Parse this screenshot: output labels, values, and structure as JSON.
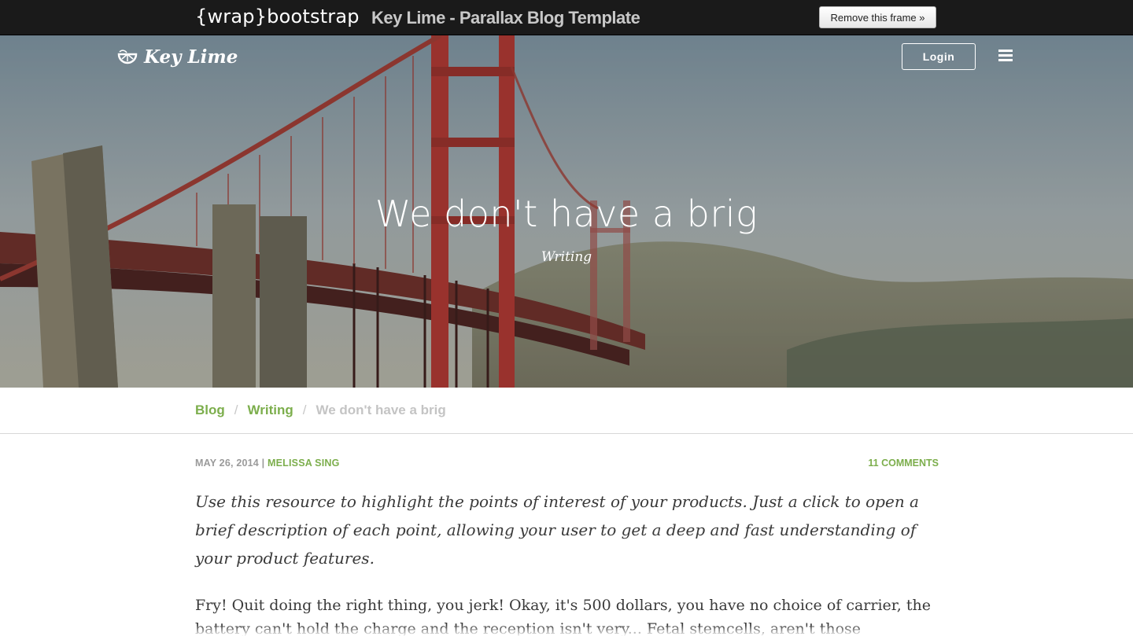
{
  "frame": {
    "logo_text": "{wrap}bootstrap",
    "title": "Key Lime - Parallax Blog Template",
    "remove_button": "Remove this frame »"
  },
  "nav": {
    "brand": "Key Lime",
    "brand_icon": "lime-slice-icon",
    "login_label": "Login",
    "menu_icon": "hamburger-menu-icon"
  },
  "hero": {
    "title": "We don't have a brig",
    "category": "Writing"
  },
  "breadcrumb": {
    "items": [
      {
        "label": "Blog"
      },
      {
        "label": "Writing"
      }
    ],
    "separator": "/",
    "current": "We don't have a brig"
  },
  "post": {
    "date": "MAY 26, 2014",
    "meta_separator": "|",
    "author": "MELISSA SING",
    "comments": "11 COMMENTS",
    "lead": "Use this resource to highlight the points of interest of your products. Just a click to open a brief description of each point, allowing your user to get a deep and fast understanding of your product features.",
    "body": "Fry! Quit doing the right thing, you jerk! Okay, it's 500 dollars, you have no choice of carrier, the battery can't hold the charge and the reception isn't very... Fetal stemcells, aren't those controversial?"
  },
  "colors": {
    "accent_green": "#7cae4c",
    "frame_bar": "#1a1a1a",
    "bridge_red": "#b2332a"
  }
}
